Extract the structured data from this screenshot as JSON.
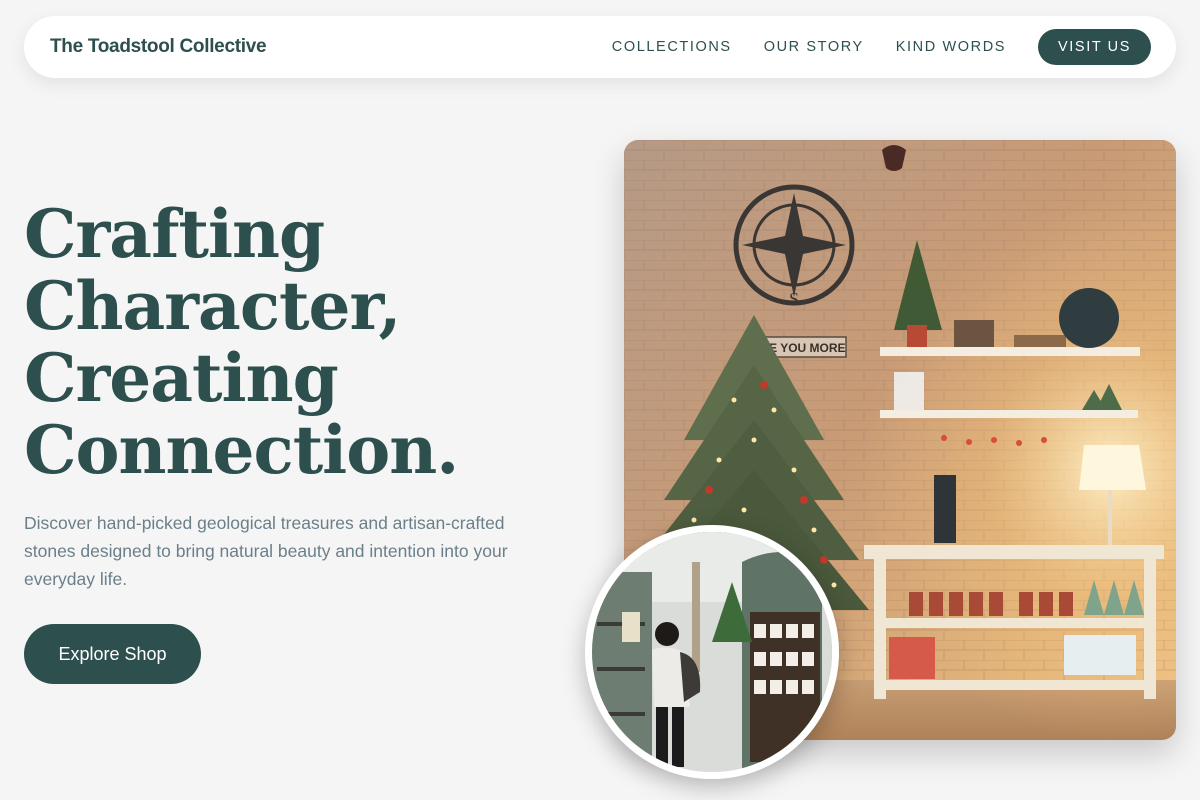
{
  "nav": {
    "brand": "The Toadstool Collective",
    "links": [
      "COLLECTIONS",
      "OUR STORY",
      "KIND WORDS"
    ],
    "cta": "VISIT US"
  },
  "hero": {
    "title_lines": [
      "Crafting",
      "Character,",
      "Creating",
      "Connection."
    ],
    "subtitle": "Discover hand-picked geological treasures and artisan-crafted stones designed to bring natural beauty and intention into your everyday life.",
    "button": "Explore Shop"
  },
  "images": {
    "main": {
      "sign_text": "LOVE YOU MORE"
    }
  },
  "colors": {
    "accent": "#2d4f4e",
    "background": "#f5f5f5",
    "subtitle": "#6b7f8a"
  }
}
